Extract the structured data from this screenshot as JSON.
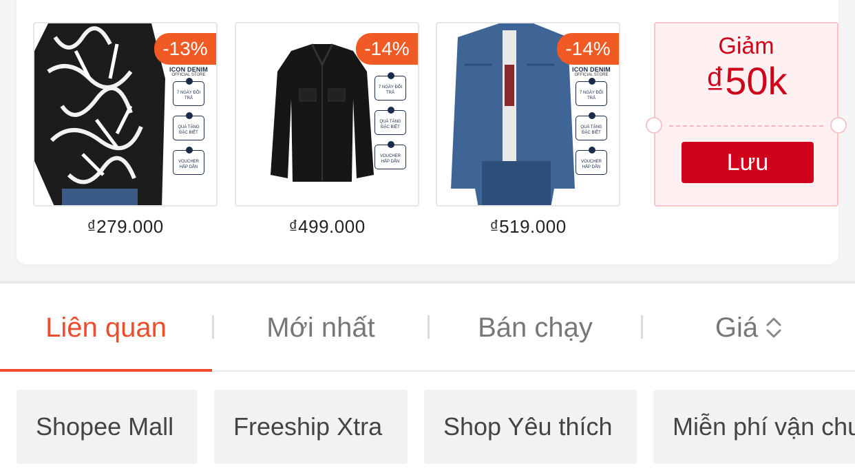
{
  "products": [
    {
      "discount": "-13%",
      "price": "₫279.000",
      "image": "graffiti-print-shirt"
    },
    {
      "discount": "-14%",
      "price": "₫499.000",
      "image": "black-denim-jacket"
    },
    {
      "discount": "-14%",
      "price": "₫519.000",
      "image": "blue-denim-jacket"
    }
  ],
  "store_banner": {
    "title": "ICON DENIM",
    "subtitle": "OFFICIAL STORE",
    "items": [
      "7 NGÀY ĐỔI TRẢ",
      "QUÀ TẶNG ĐẶC BIỆT",
      "VOUCHER HẤP DẪN"
    ]
  },
  "voucher": {
    "label": "Giảm",
    "amount": "₫50k",
    "button": "Lưu"
  },
  "sort_tabs": [
    {
      "label": "Liên quan",
      "active": true
    },
    {
      "label": "Mới nhất",
      "active": false
    },
    {
      "label": "Bán chạy",
      "active": false
    },
    {
      "label": "Giá",
      "active": false,
      "icon": "sort-updown-icon"
    }
  ],
  "filters": [
    "Shopee Mall",
    "Freeship Xtra",
    "Shop Yêu thích",
    "Miễn phí vận chuyển"
  ],
  "colors": {
    "accent": "#ee4d2d",
    "voucher_red": "#d0021b",
    "badge": "#f05a24"
  }
}
